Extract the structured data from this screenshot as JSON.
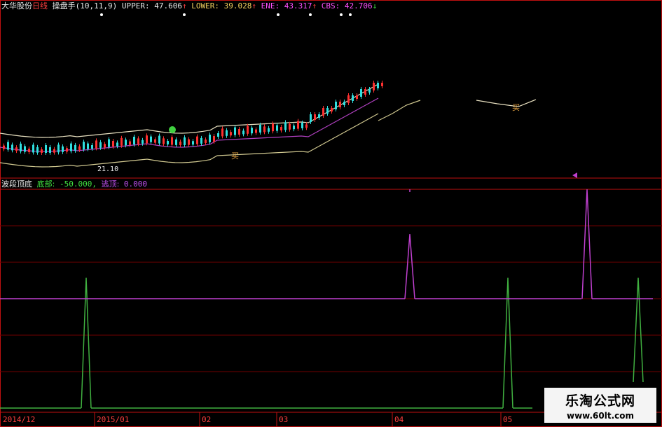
{
  "main_panel": {
    "stock_name": "大华股份",
    "period": "日线",
    "indicator_name": "操盘手",
    "indicator_params": "(10,11,9)",
    "upper_label": "UPPER:",
    "upper_value": "47.606",
    "lower_label": "LOWER:",
    "lower_value": "39.028",
    "ene_label": "ENE:",
    "ene_value": "43.317",
    "cbs_label": "CBS:",
    "cbs_value": "42.706",
    "arrow_up": "↑",
    "arrow_down": "↓",
    "low_price_marker": "21.10",
    "buy_label": "买"
  },
  "sub_panel": {
    "indicator_name": "波段顶底",
    "bottom_label": "底部:",
    "bottom_value": "-50.000,",
    "top_label": "逃顶:",
    "top_value": "0.000"
  },
  "x_axis": {
    "labels": [
      "2014/12",
      "2015/01",
      "02",
      "03",
      "04",
      "05"
    ]
  },
  "watermark": {
    "title": "乐淘公式网",
    "url": "www.60lt.com"
  },
  "colors": {
    "background": "#000000",
    "border": "#c01010",
    "gridline": "#700000",
    "upper_band": "#e8e0c0",
    "lower_band": "#d0c890",
    "middle_band": "#b040c0",
    "candle_up": "#ff3030",
    "candle_down": "#30e0e0",
    "bottom_signal": "#40b040",
    "top_signal": "#c040d0"
  }
}
